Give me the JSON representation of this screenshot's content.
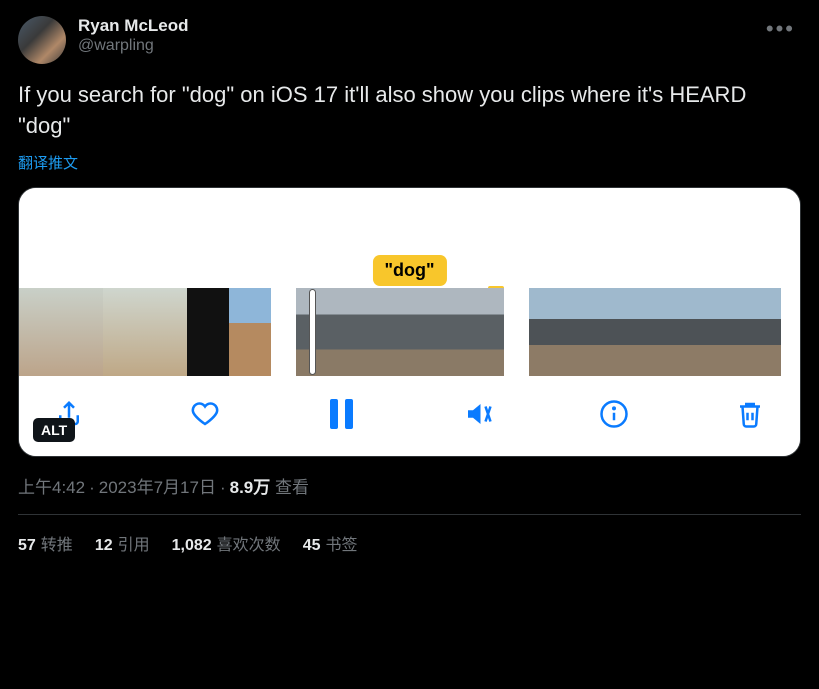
{
  "user": {
    "display_name": "Ryan McLeod",
    "handle": "@warpling"
  },
  "tweet_text": "If you search for \"dog\" on iOS 17 it'll also show you clips where it's HEARD \"dog\"",
  "translate_label": "翻译推文",
  "media": {
    "tag_text": "\"dog\"",
    "alt_badge": "ALT"
  },
  "meta": {
    "time": "上午4:42",
    "date": "2023年7月17日",
    "views_count": "8.9万",
    "views_label": "查看"
  },
  "engagement": {
    "retweets": {
      "count": "57",
      "label": "转推"
    },
    "quotes": {
      "count": "12",
      "label": "引用"
    },
    "likes": {
      "count": "1,082",
      "label": "喜欢次数"
    },
    "bookmarks": {
      "count": "45",
      "label": "书签"
    }
  },
  "icons": {
    "share": "share-icon",
    "heart": "heart-icon",
    "pause": "pause-icon",
    "mute": "mute-icon",
    "info": "info-icon",
    "trash": "trash-icon"
  }
}
